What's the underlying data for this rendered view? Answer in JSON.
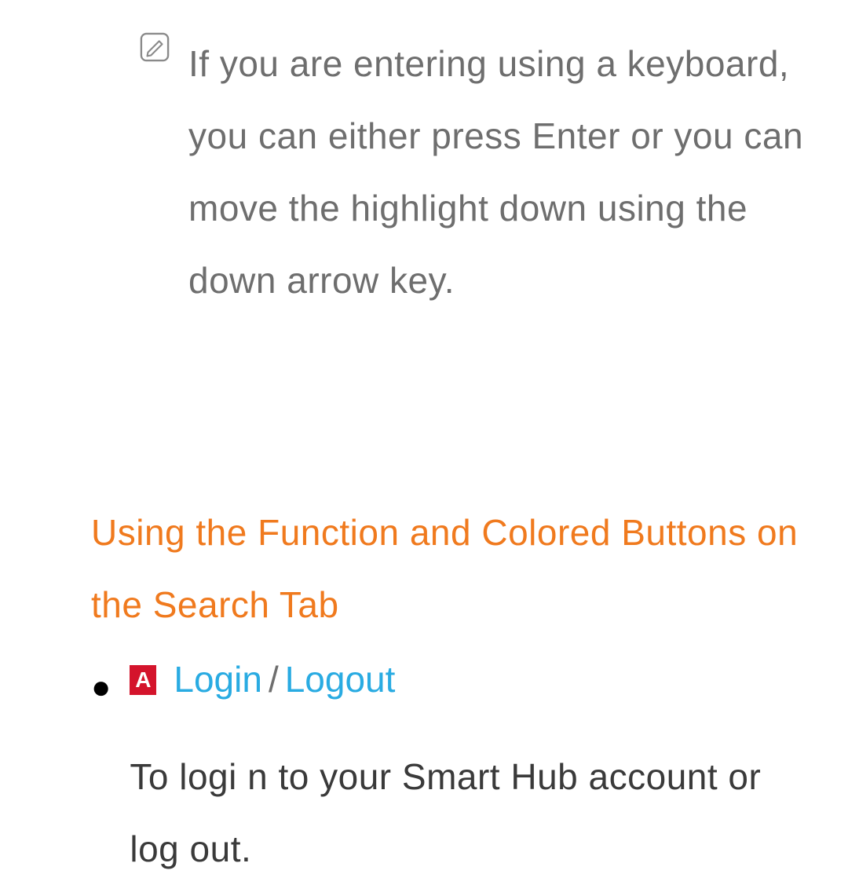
{
  "note": {
    "text": "If you are entering using a keyboard, you can either press Enter or you can move the highlight down using the down arrow key."
  },
  "heading": "Using the Function and Colored Buttons on the Search Tab",
  "list": {
    "item1": {
      "buttonLetter": "A",
      "login": "Login",
      "separator": "/",
      "logout": "Logout",
      "body": "To logi n to your Smart Hub account or log out."
    }
  }
}
